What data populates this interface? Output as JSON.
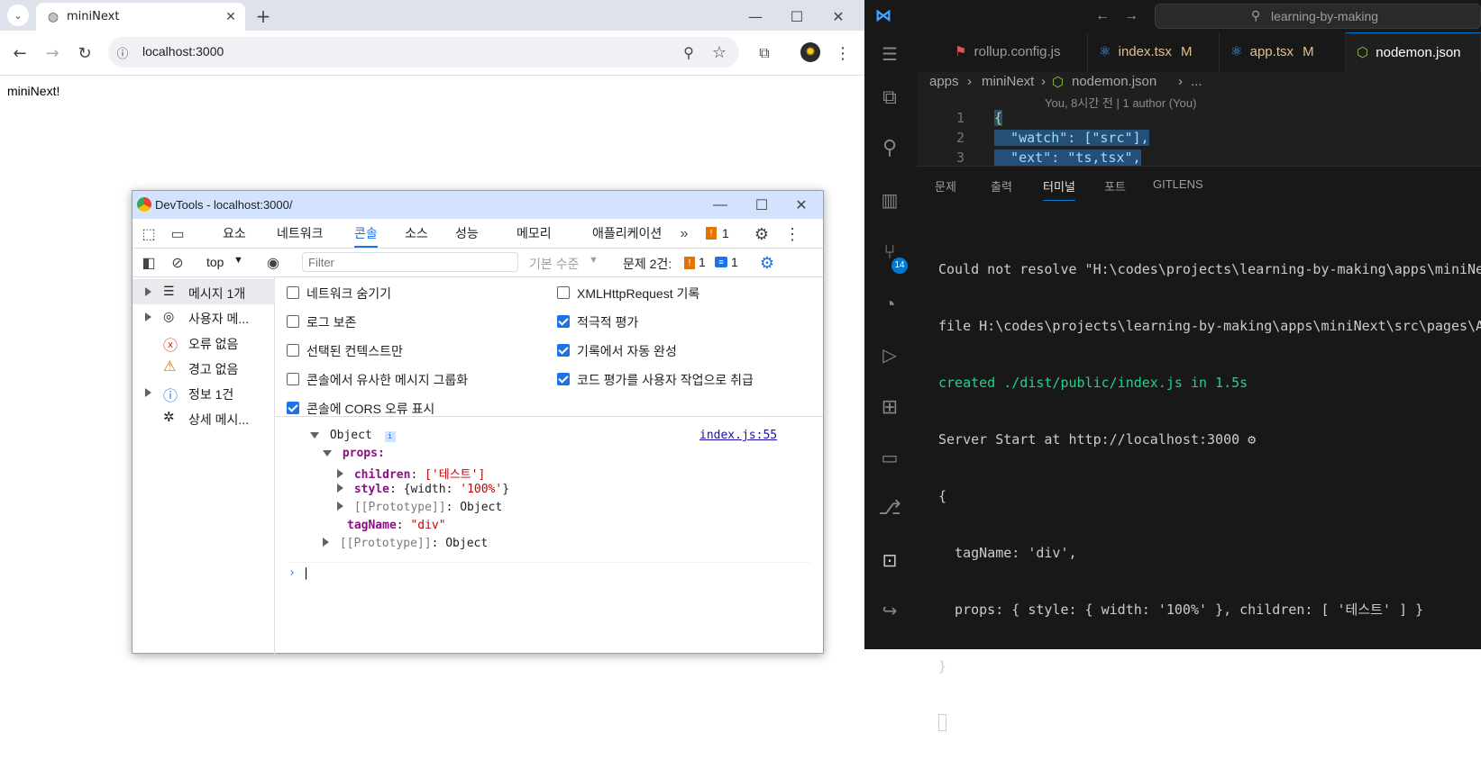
{
  "browser": {
    "tab_title": "miniNext",
    "url": "localhost:3000",
    "page_text": "miniNext!"
  },
  "devtools": {
    "title": "DevTools - localhost:3000/",
    "tabs": [
      "요소",
      "네트워크",
      "콘솔",
      "소스",
      "성능",
      "메모리",
      "애플리케이션"
    ],
    "active_tab": "콘솔",
    "issue_badge": "1",
    "context": "top",
    "filter_placeholder": "Filter",
    "level": "기본 수준",
    "issues_label": "문제 2건:",
    "issues_warn": "1",
    "issues_info": "1",
    "sidebar": [
      {
        "label": "메시지 1개",
        "icon": "list-icon"
      },
      {
        "label": "사용자 메...",
        "icon": "user-icon"
      },
      {
        "label": "오류 없음",
        "icon": "error-icon"
      },
      {
        "label": "경고 없음",
        "icon": "warning-icon"
      },
      {
        "label": "정보 1건",
        "icon": "info-icon"
      },
      {
        "label": "상세 메시...",
        "icon": "bug-icon"
      }
    ],
    "settings_left": [
      {
        "label": "네트워크 숨기기",
        "checked": false
      },
      {
        "label": "로그 보존",
        "checked": false
      },
      {
        "label": "선택된 컨텍스트만",
        "checked": false
      },
      {
        "label": "콘솔에서 유사한 메시지 그룹화",
        "checked": false
      },
      {
        "label": "콘솔에 CORS 오류 표시",
        "checked": true
      }
    ],
    "settings_right": [
      {
        "label": "XMLHttpRequest 기록",
        "checked": false
      },
      {
        "label": "적극적 평가",
        "checked": true
      },
      {
        "label": "기록에서 자동 완성",
        "checked": true
      },
      {
        "label": "코드 평가를 사용자 작업으로 취급",
        "checked": true
      }
    ],
    "log": {
      "source": "index.js:55",
      "object_label": "Object",
      "info_badge": "i",
      "props_key": "props",
      "children_key": "children",
      "children_val": "['테스트']",
      "style_key": "style",
      "style_val_pre": "{width: ",
      "style_val_str": "'100%'",
      "style_val_post": "}",
      "proto_label": "[[Prototype]]",
      "proto_val": "Object",
      "tagname_key": "tagName",
      "tagname_val": "\"div\""
    }
  },
  "vscode": {
    "search": "learning-by-making",
    "tabs": [
      {
        "label": "rollup.config.js",
        "badge": ""
      },
      {
        "label": "index.tsx",
        "badge": "M"
      },
      {
        "label": "app.tsx",
        "badge": "M"
      },
      {
        "label": "nodemon.json",
        "badge": ""
      }
    ],
    "breadcrumb": [
      "apps",
      "miniNext",
      "nodemon.json",
      "..."
    ],
    "blame": "You, 8시간 전 | 1 author (You)",
    "code_lines": [
      {
        "num": "1",
        "text": "{"
      },
      {
        "num": "2",
        "text": "  \"watch\": [\"src\"],"
      },
      {
        "num": "3",
        "text": "  \"ext\": \"ts,tsx\","
      }
    ],
    "panel_tabs": [
      "문제",
      "출력",
      "터미널",
      "포트",
      "GITLENS"
    ],
    "active_panel_tab": "터미널",
    "scm_badge": "14",
    "terminal": [
      "Could not resolve \"H:\\codes\\projects\\learning-by-making\\apps\\miniNe",
      "file H:\\codes\\projects\\learning-by-making\\apps\\miniNext\\src\\pages\\A",
      "created ./dist/public/index.js in 1.5s",
      "Server Start at http://localhost:3000 ⚙",
      "{",
      "  tagName: 'div',",
      "  props: { style: { width: '100%' }, children: [ '테스트' ] }",
      "}"
    ]
  }
}
